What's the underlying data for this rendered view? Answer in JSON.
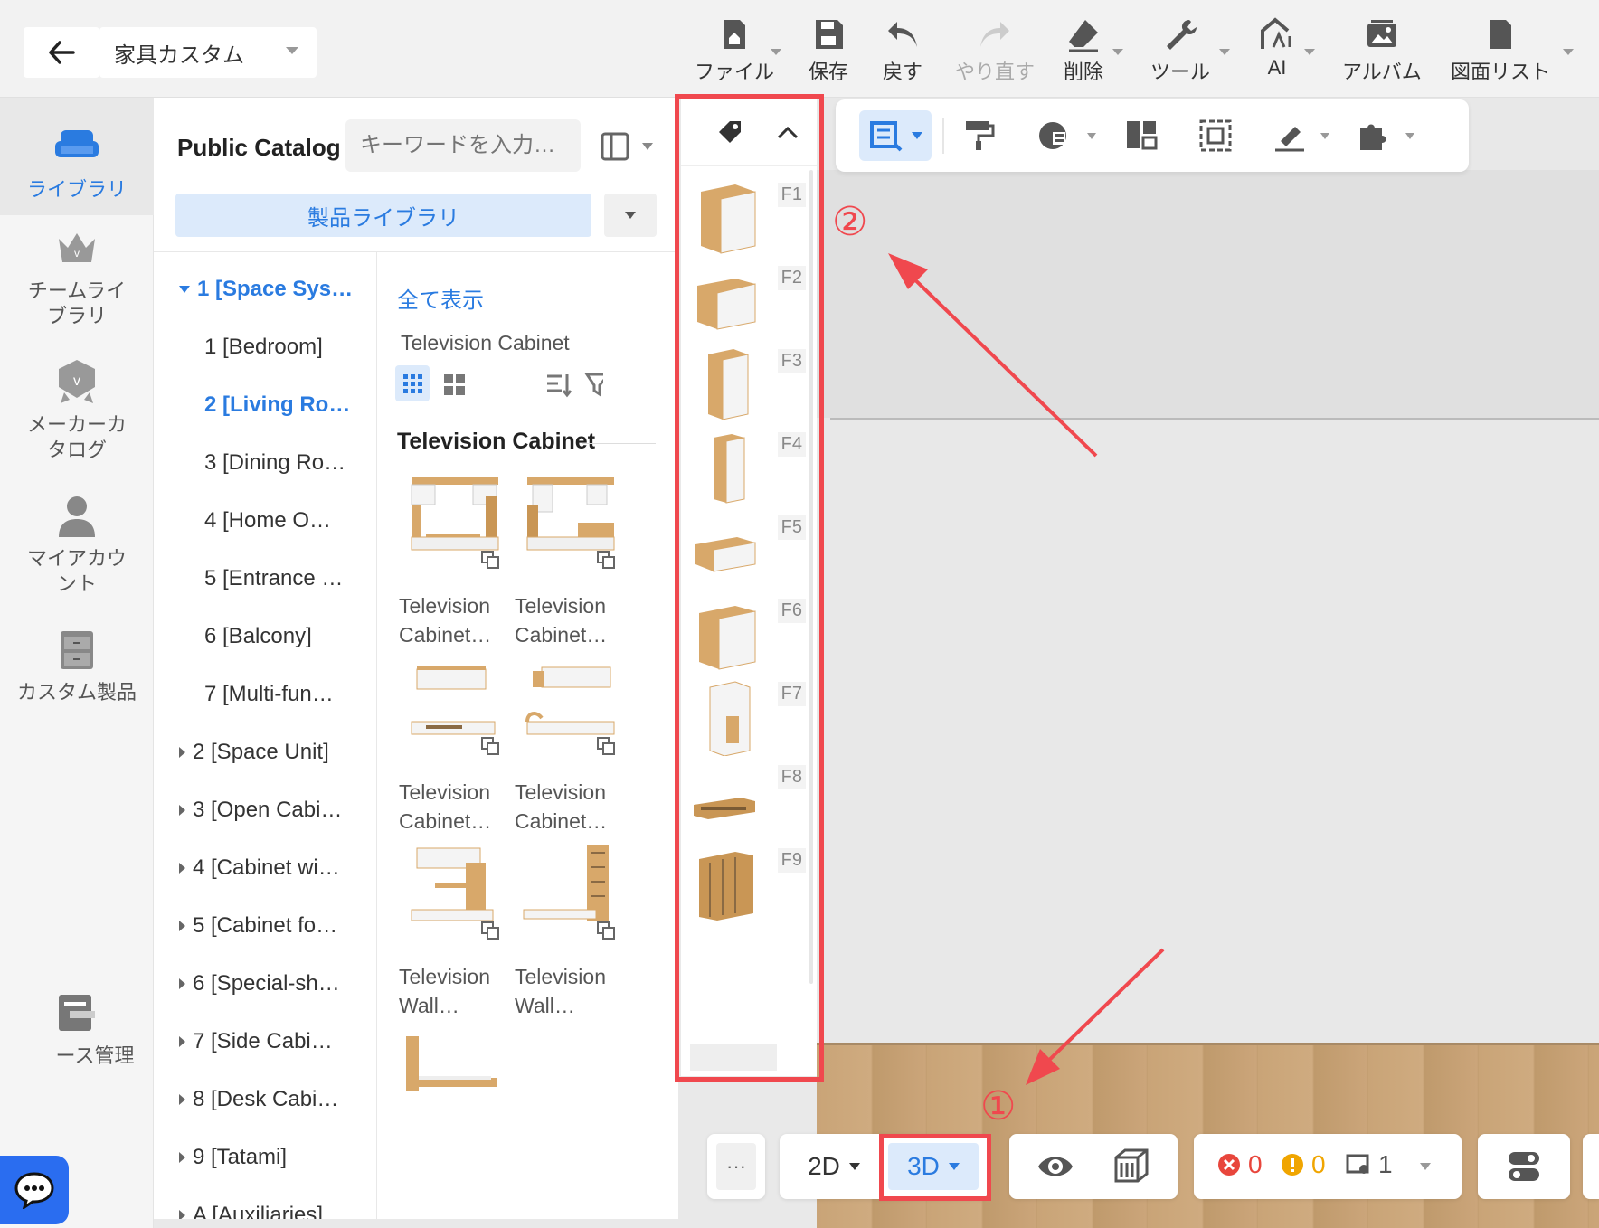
{
  "topbar": {
    "project_name": "家具カスタム",
    "tools": [
      {
        "label": "ファイル",
        "icon": "home-file-icon"
      },
      {
        "label": "保存",
        "icon": "save-icon"
      },
      {
        "label": "戻す",
        "icon": "undo-icon"
      },
      {
        "label": "やり直す",
        "icon": "redo-icon"
      },
      {
        "label": "削除",
        "icon": "eraser-icon"
      },
      {
        "label": "ツール",
        "icon": "wrench-icon"
      },
      {
        "label": "AI",
        "icon": "ai-icon"
      },
      {
        "label": "アルバム",
        "icon": "album-icon"
      },
      {
        "label": "図面リスト",
        "icon": "drawing-list-icon"
      }
    ]
  },
  "rail": {
    "items": [
      {
        "label": "ライブラリ",
        "icon": "sofa-icon"
      },
      {
        "label": "チームライブラリ",
        "icon": "crown-icon"
      },
      {
        "label": "メーカーカタログ",
        "icon": "badge-icon"
      },
      {
        "label": "マイアカウント",
        "icon": "user-icon"
      },
      {
        "label": "カスタム製品",
        "icon": "cabinet-icon"
      },
      {
        "label": "ース管理",
        "icon": "resource-icon"
      }
    ]
  },
  "catalog": {
    "title": "Public Catalog",
    "search_placeholder": "キーワードを入力…",
    "library_button": "製品ライブラリ",
    "tree": [
      {
        "label": "1 [Space Sys…",
        "level": 0,
        "expanded": true,
        "selected": true
      },
      {
        "label": "1 [Bedroom]",
        "level": 1
      },
      {
        "label": "2 [Living Ro…",
        "level": 1,
        "selected": true
      },
      {
        "label": "3 [Dining Ro…",
        "level": 1
      },
      {
        "label": "4 [Home O…",
        "level": 1
      },
      {
        "label": "5 [Entrance …",
        "level": 1
      },
      {
        "label": "6 [Balcony]",
        "level": 1
      },
      {
        "label": "7 [Multi-fun…",
        "level": 1
      },
      {
        "label": "2 [Space Unit]",
        "level": 0
      },
      {
        "label": "3 [Open Cabi…",
        "level": 0
      },
      {
        "label": "4 [Cabinet wi…",
        "level": 0
      },
      {
        "label": "5 [Cabinet fo…",
        "level": 0
      },
      {
        "label": "6 [Special-sh…",
        "level": 0
      },
      {
        "label": "7 [Side Cabi…",
        "level": 0
      },
      {
        "label": "8 [Desk Cabi…",
        "level": 0
      },
      {
        "label": "9 [Tatami]",
        "level": 0
      },
      {
        "label": "A [Auxiliaries]",
        "level": 0
      }
    ],
    "show_all": "全て表示",
    "sub_label": "Television Cabinet",
    "section_title": "Television Cabinet",
    "products": [
      {
        "line1": "Television",
        "line2": "Cabinet…"
      },
      {
        "line1": "Television",
        "line2": "Cabinet…"
      },
      {
        "line1": "Television",
        "line2": "Cabinet…"
      },
      {
        "line1": "Television",
        "line2": "Cabinet…"
      },
      {
        "line1": "Television",
        "line2": "Wall…"
      },
      {
        "line1": "Television",
        "line2": "Wall…"
      }
    ]
  },
  "vpanel": {
    "items": [
      "F1",
      "F2",
      "F3",
      "F4",
      "F5",
      "F6",
      "F7",
      "F8",
      "F9"
    ]
  },
  "bottom": {
    "more": "···",
    "mode_2d": "2D",
    "mode_3d": "3D",
    "errors": "0",
    "warnings": "0",
    "rooms": "1"
  },
  "annotations": {
    "one": "①",
    "two": "②"
  },
  "colors": {
    "accent": "#2a7be0",
    "highlight": "#f0484e",
    "wood": "#d8a86a"
  }
}
